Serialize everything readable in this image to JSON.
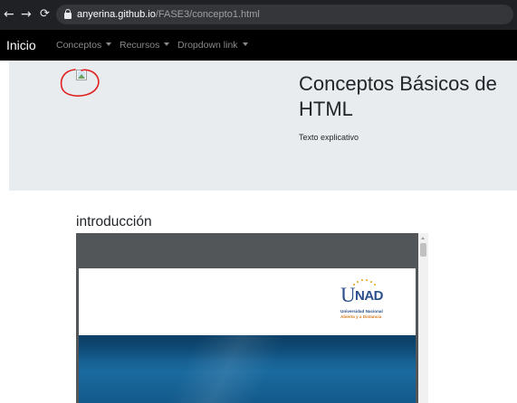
{
  "browser": {
    "url_domain": "anyerina.github.io",
    "url_path": "/FASE3/concepto1.html"
  },
  "navbar": {
    "brand": "Inicio",
    "items": [
      {
        "label": "Conceptos",
        "has_caret": true
      },
      {
        "label": "Recursos",
        "has_caret": true
      },
      {
        "label": "Dropdown link",
        "has_caret": true
      }
    ]
  },
  "jumbotron": {
    "title": "Conceptos Básicos de HTML",
    "subtitle": "Texto explicativo",
    "image_broken": true
  },
  "content": {
    "section_title": "introducción",
    "embedded_document": {
      "logo_name": "UNAD",
      "logo_line1": "Universidad Nacional",
      "logo_line2": "Abierta y a Distancia"
    }
  },
  "colors": {
    "browser_bar": "#202124",
    "navbar": "#000000",
    "jumbotron": "#e9ecef",
    "annotation": "#e02020",
    "pdf_blue": "#1a6a9f"
  },
  "icons": {
    "back": "arrow-left",
    "forward": "arrow-right",
    "reload": "reload",
    "lock": "lock"
  }
}
